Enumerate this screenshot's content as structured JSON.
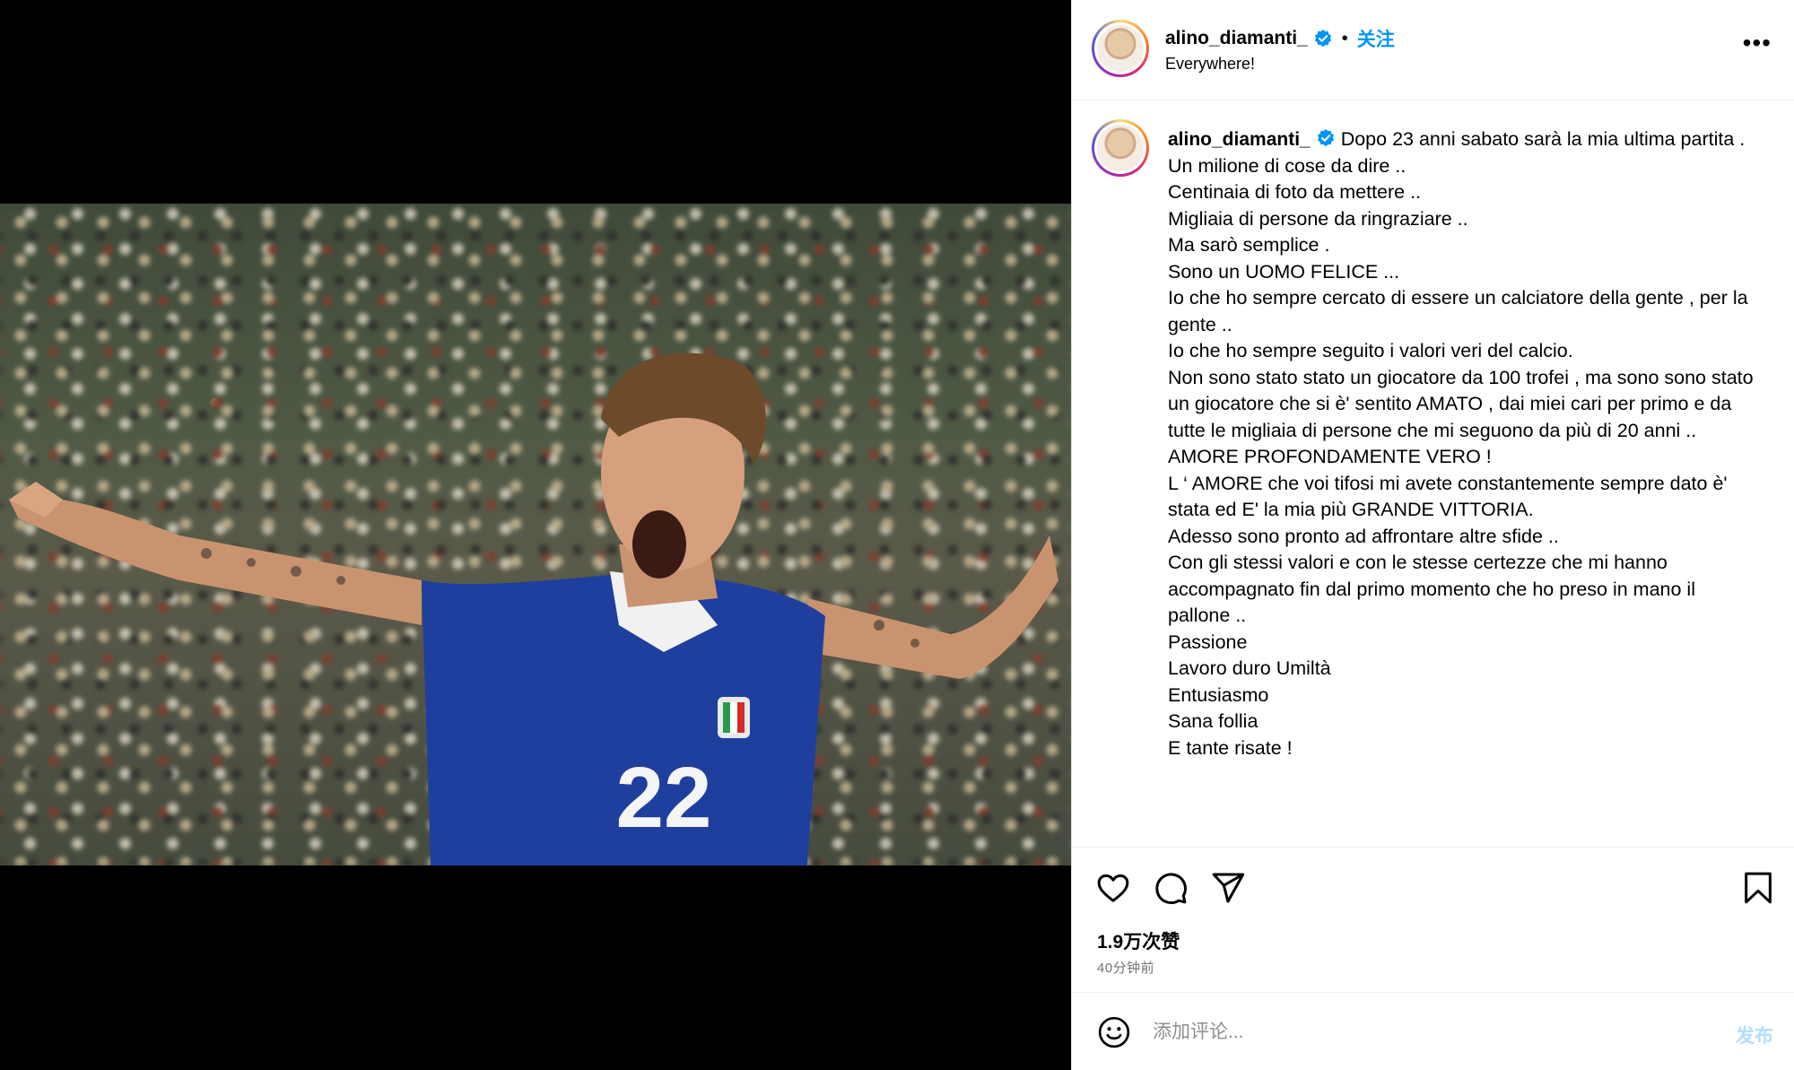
{
  "post": {
    "image_alt": "Footballer in blue #22 jersey celebrating with arms outstretched",
    "jersey_number": "22"
  },
  "header": {
    "username": "alino_diamanti_",
    "verified": true,
    "separator": "•",
    "follow_label": "关注",
    "location": "Everywhere!",
    "more_label": "•••"
  },
  "caption": {
    "username": "alino_diamanti_",
    "lines": [
      "Dopo 23 anni sabato sarà la mia ultima partita .",
      "Un milione di cose da dire ..",
      "Centinaia di foto da mettere ..",
      "Migliaia di persone da ringraziare ..",
      "Ma sarò semplice .",
      "Sono un UOMO FELICE ...",
      "Io che ho sempre cercato di essere un calciatore della gente , per la gente ..",
      "Io che ho sempre seguito i valori veri del calcio.",
      "Non sono stato stato un giocatore da 100 trofei , ma sono sono stato un giocatore che si è' sentito AMATO , dai miei cari per primo e da tutte le migliaia di persone che mi seguono da più di 20 anni ..",
      "AMORE PROFONDAMENTE VERO !",
      "L ‘ AMORE che voi tifosi mi avete constantemente sempre dato è' stata ed E' la mia più GRANDE VITTORIA.",
      "Adesso sono pronto ad affrontare altre sfide ..",
      "Con gli stessi valori e con le stesse certezze che mi hanno accompagnato fin dal primo momento che ho preso in mano il pallone ..",
      "Passione",
      "Lavoro duro Umiltà",
      "Entusiasmo",
      "Sana follia",
      "E tante risate !"
    ]
  },
  "actions": {
    "icons": [
      "heart-icon",
      "comment-icon",
      "share-icon",
      "bookmark-icon"
    ],
    "likes": "1.9万次赞",
    "time": "40分钟前"
  },
  "comment": {
    "emoji_icon": "smiley-icon",
    "placeholder": "添加评论...",
    "post_label": "发布"
  },
  "colors": {
    "accent": "#0095f6",
    "post_disabled": "#b2dffc",
    "secondary_text": "#737373",
    "jersey_blue": "#1f3f9e"
  }
}
